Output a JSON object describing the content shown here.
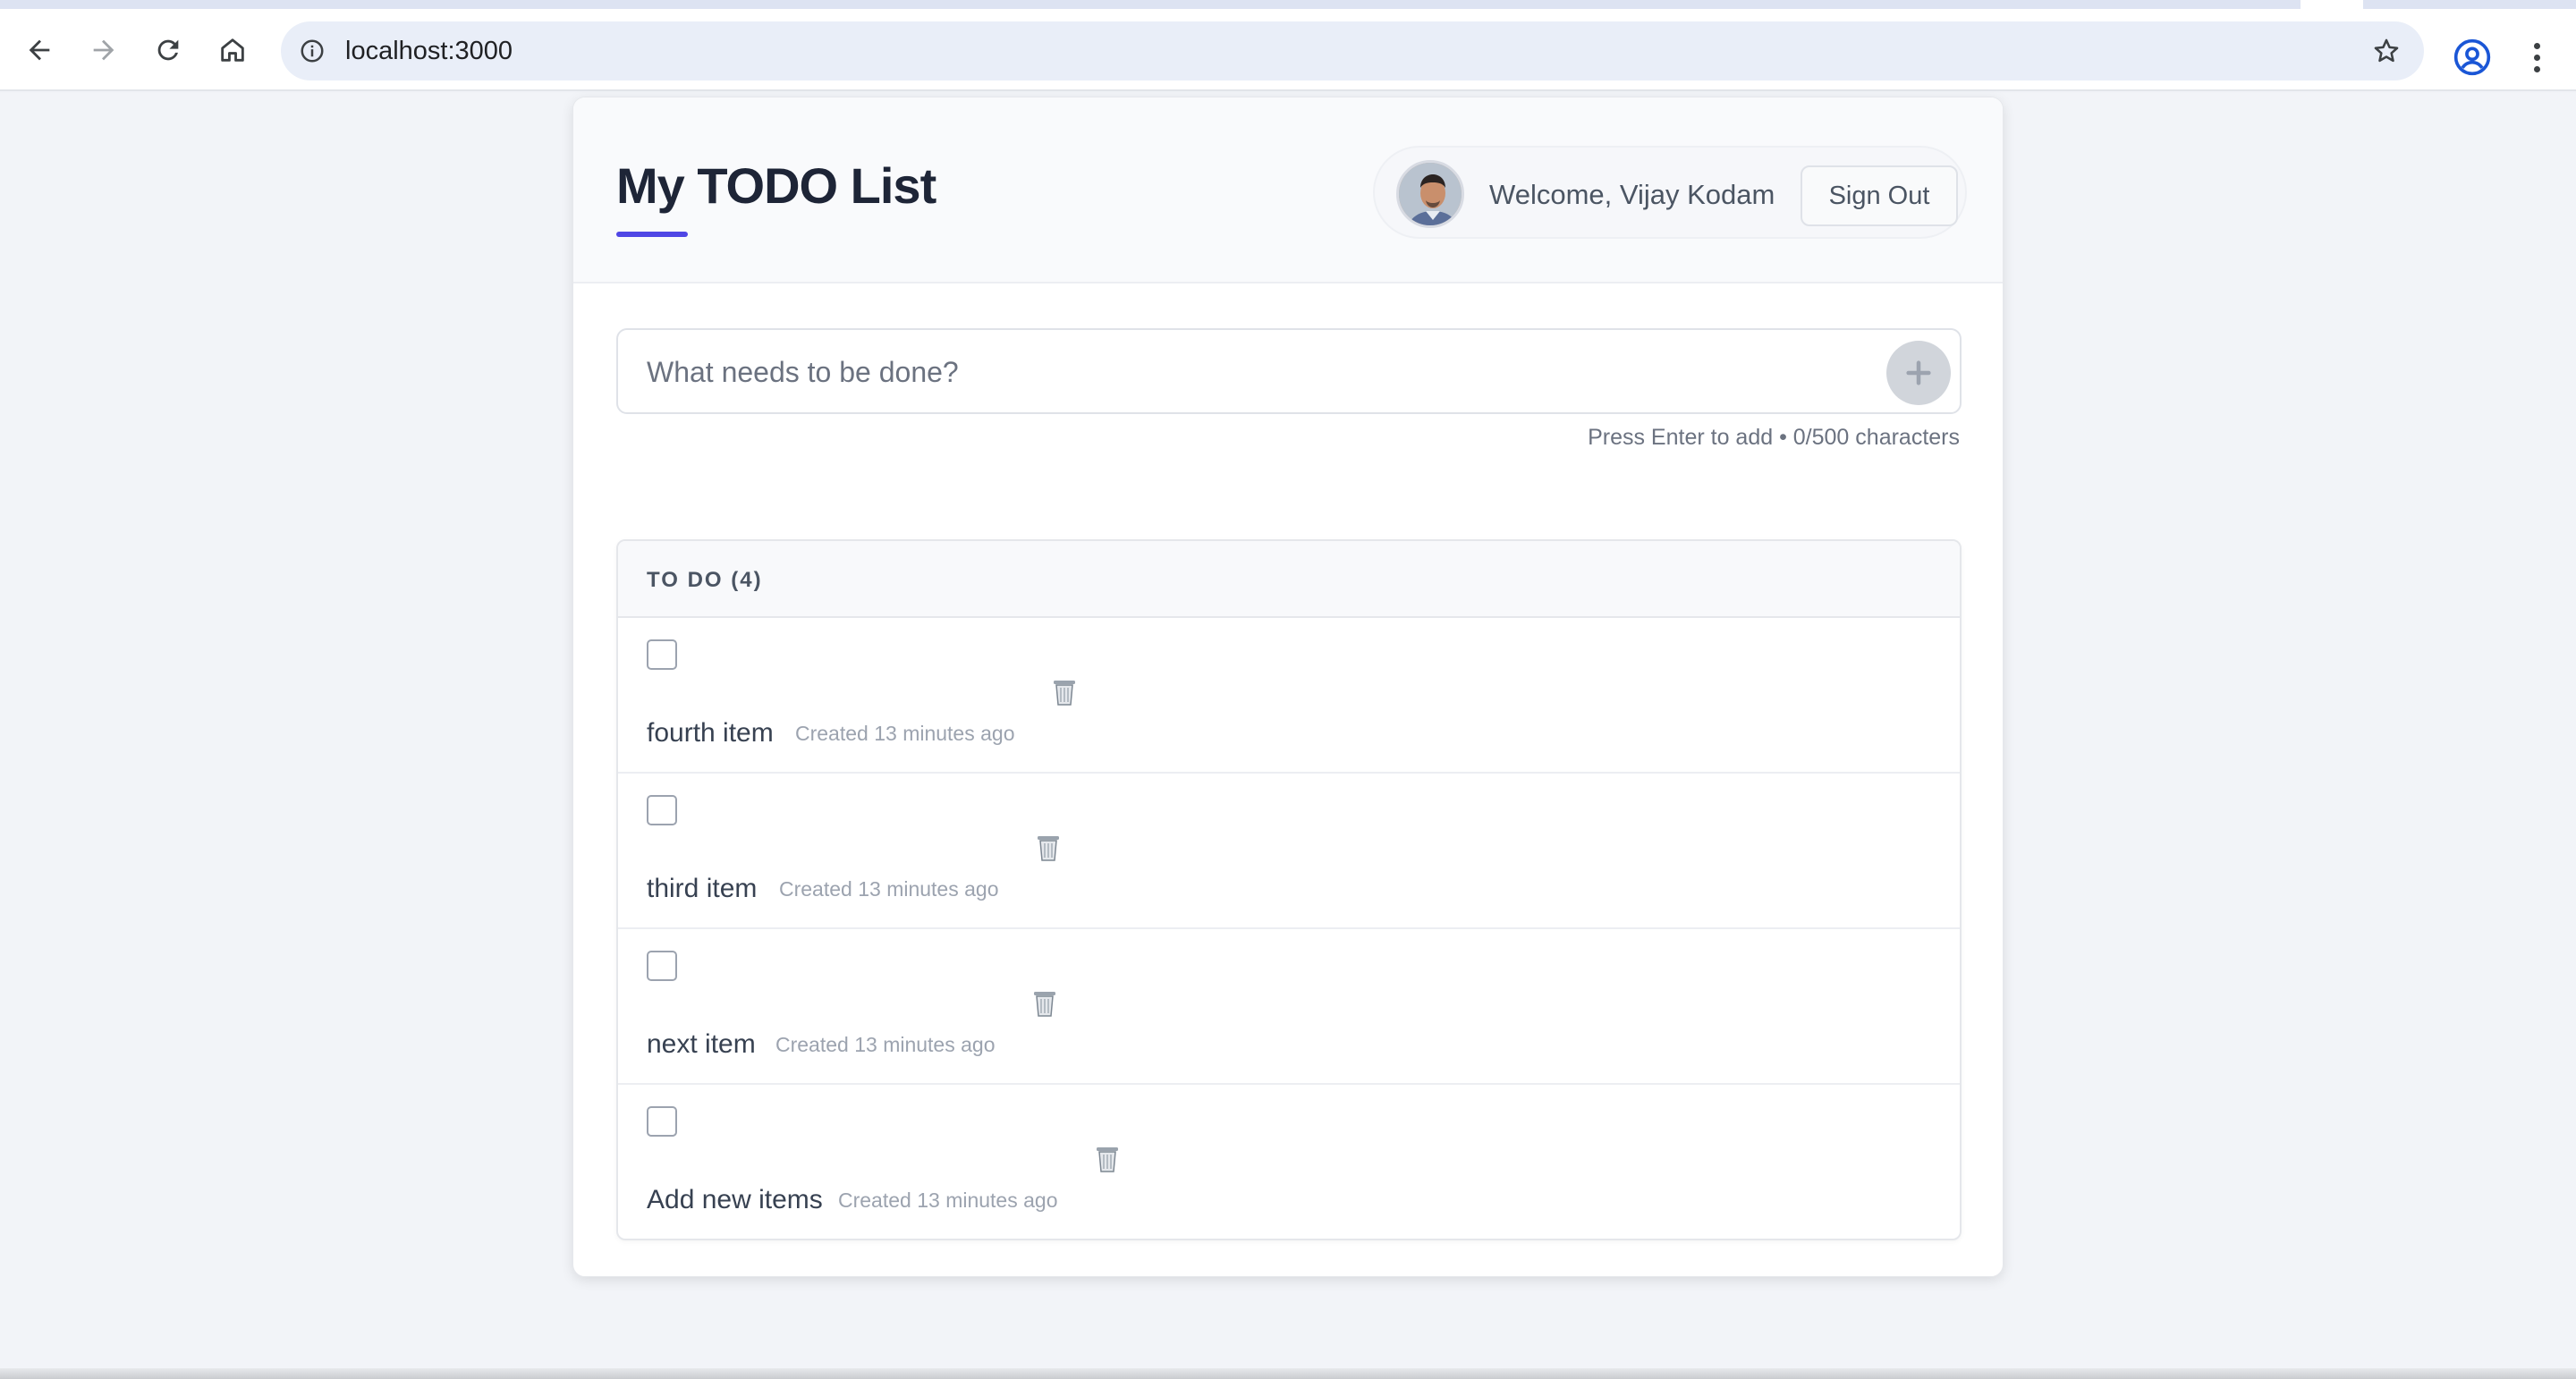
{
  "browser": {
    "url": "localhost:3000"
  },
  "app": {
    "title": "My TODO List",
    "accent_color": "#4f46e5"
  },
  "user": {
    "welcome": "Welcome, Vijay Kodam",
    "sign_out_label": "Sign Out"
  },
  "new_todo": {
    "placeholder": "What needs to be done?",
    "value": "",
    "hint": "Press Enter to add • 0/500 characters"
  },
  "todo_list": {
    "header": "TO DO (4)",
    "items": [
      {
        "text": "fourth item",
        "meta": "Created 13 minutes ago",
        "completed": false
      },
      {
        "text": "third item",
        "meta": "Created 13 minutes ago",
        "completed": false
      },
      {
        "text": "next item",
        "meta": "Created 13 minutes ago",
        "completed": false
      },
      {
        "text": "Add new items",
        "meta": "Created 13 minutes ago",
        "completed": false
      }
    ]
  }
}
